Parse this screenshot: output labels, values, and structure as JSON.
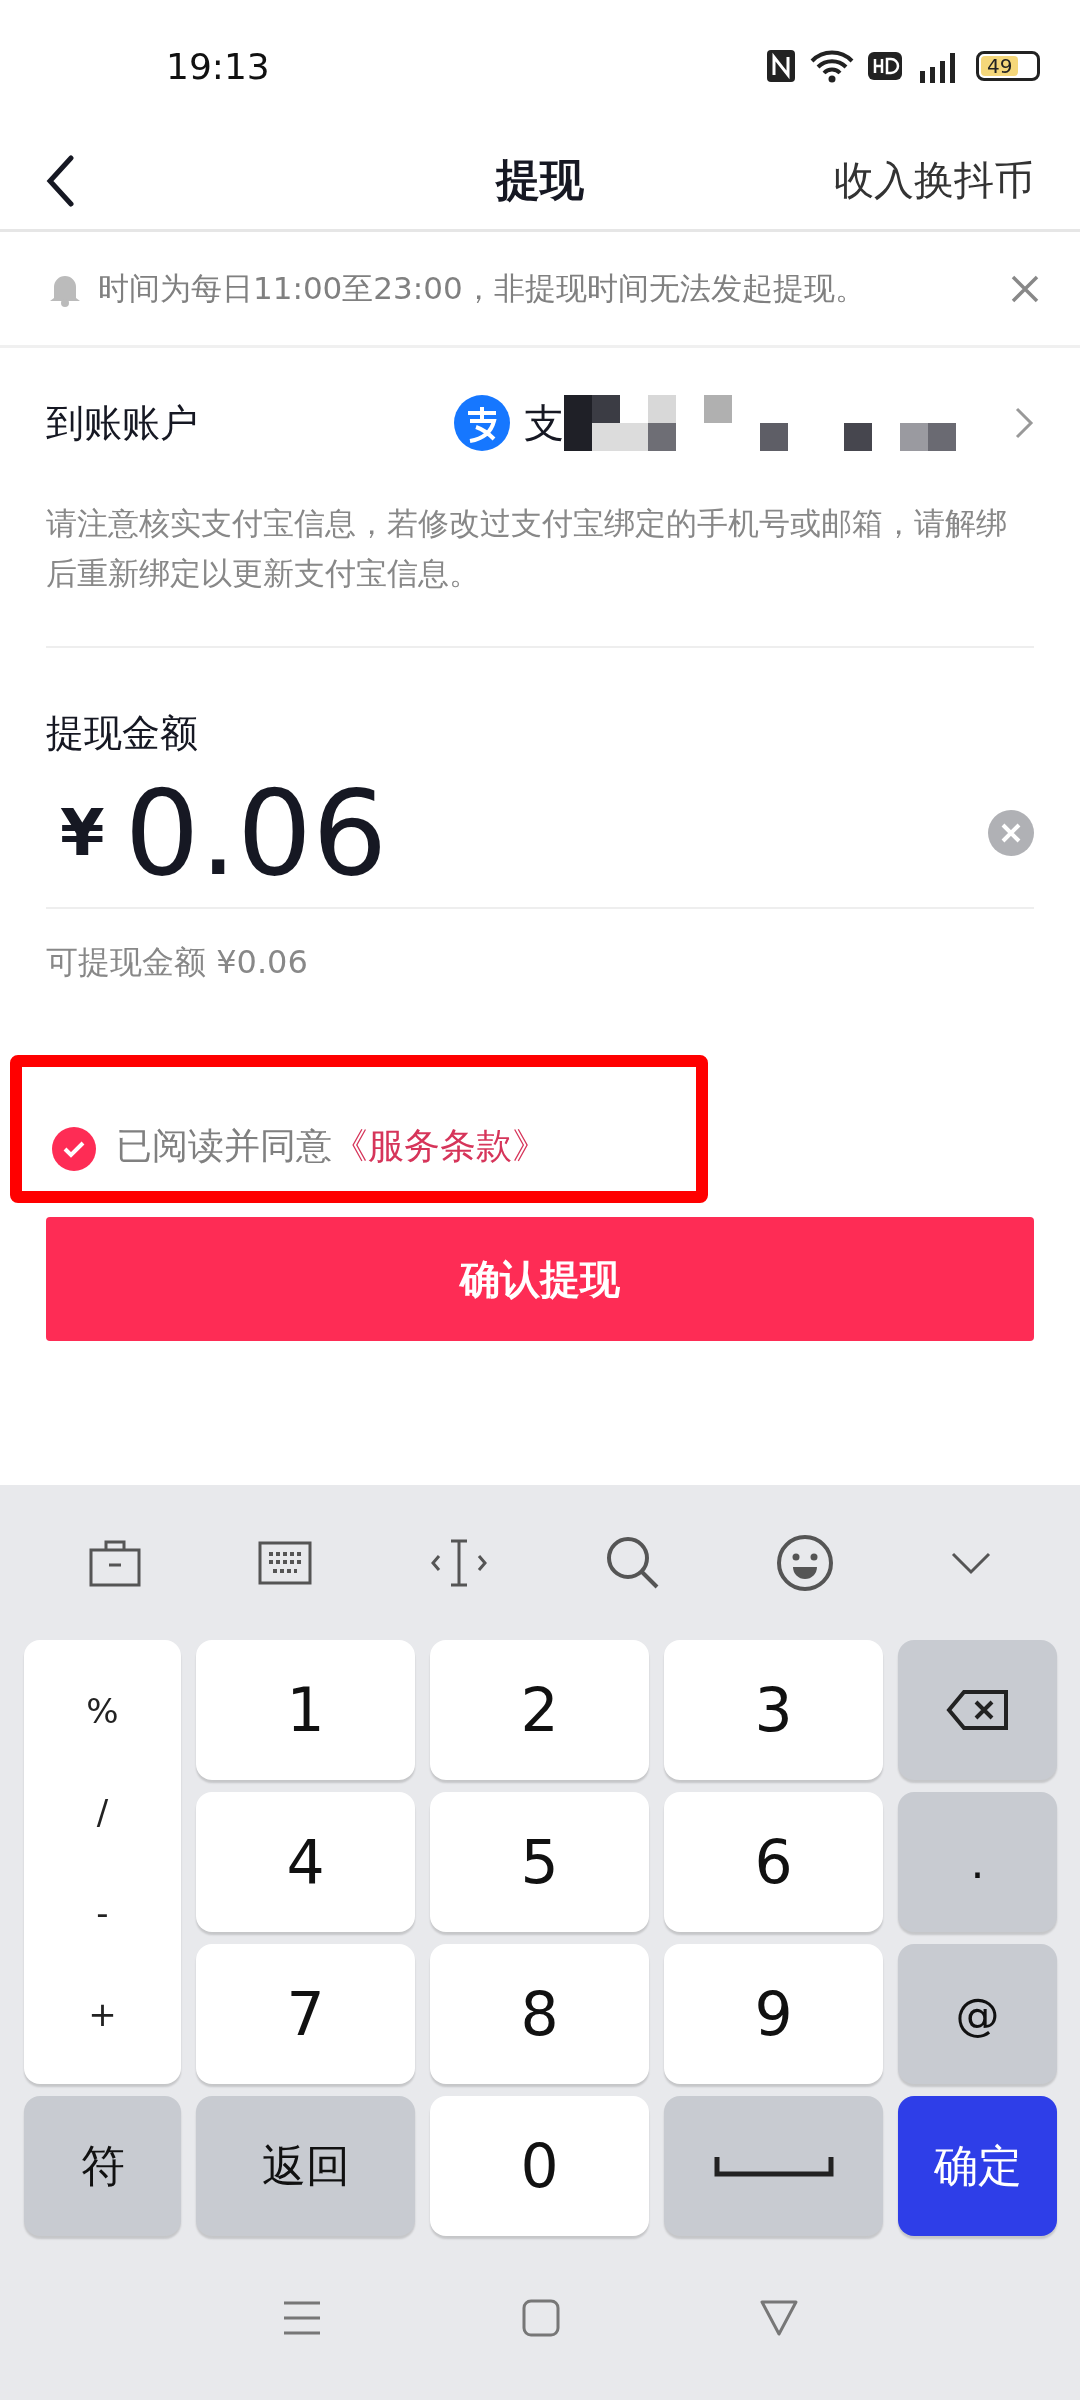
{
  "status_bar": {
    "time": "19:13",
    "battery": "49"
  },
  "header": {
    "title": "提现",
    "action": "收入换抖币"
  },
  "notice": {
    "text": "时间为每日11:00至23:00，非提现时间无法发起提现。"
  },
  "account": {
    "label": "到账账户",
    "value": "支",
    "note": "请注意核实支付宝信息，若修改过支付宝绑定的手机号或邮箱，请解绑后重新绑定以更新支付宝信息。"
  },
  "amount": {
    "label": "提现金额",
    "currency": "¥",
    "value": "0.06",
    "available": "可提现金额 ¥0.06"
  },
  "agreement": {
    "checked": true,
    "text": "已阅读并同意",
    "link": "《服务条款》"
  },
  "submit": {
    "label": "确认提现"
  },
  "keyboard": {
    "symbols": [
      "%",
      "/",
      "-",
      "+"
    ],
    "keys": [
      {
        "kind": "light",
        "label": "1"
      },
      {
        "kind": "light",
        "label": "2"
      },
      {
        "kind": "light",
        "label": "3"
      },
      {
        "kind": "backspace"
      },
      {
        "kind": "light",
        "label": "4"
      },
      {
        "kind": "light",
        "label": "5"
      },
      {
        "kind": "light",
        "label": "6"
      },
      {
        "kind": "dark",
        "label": "."
      },
      {
        "kind": "light",
        "label": "7"
      },
      {
        "kind": "light",
        "label": "8"
      },
      {
        "kind": "light",
        "label": "9"
      },
      {
        "kind": "dark",
        "label": "@"
      },
      {
        "kind": "dark",
        "label": "符"
      },
      {
        "kind": "dark",
        "label": "返回"
      },
      {
        "kind": "light",
        "label": "0"
      },
      {
        "kind": "space"
      },
      {
        "kind": "confirm",
        "label": "确定"
      }
    ]
  }
}
